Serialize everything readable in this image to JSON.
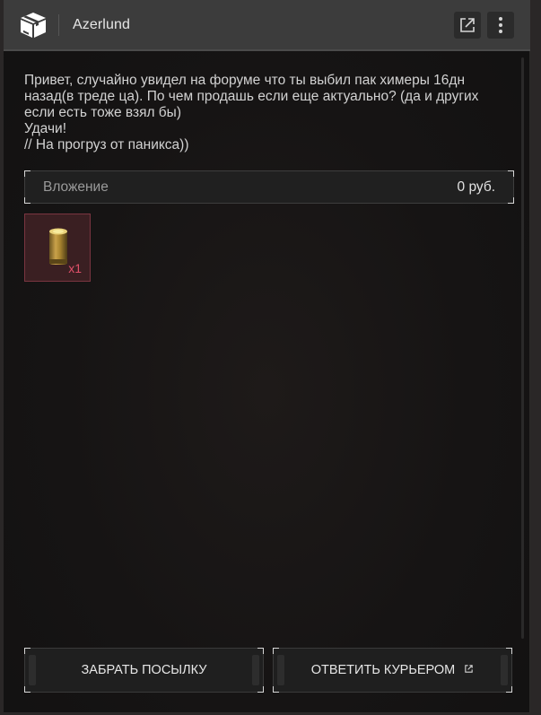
{
  "header": {
    "title": "Azerlund",
    "app_icon": "package-box-icon",
    "open_external_icon": "external-link-icon",
    "menu_icon": "vertical-dots-icon"
  },
  "message": {
    "text": "Привет, случайно увидел на форуме что ты выбил пак химеры 16дн\nназад(в треде ца). По чем продашь если еще актуально? (да и других\nесли есть тоже взял бы)\nУдачи!\n// На прогруз от паникса))"
  },
  "attachment": {
    "label": "Вложение",
    "amount": "0 руб."
  },
  "items": [
    {
      "icon": "cartridge-icon",
      "count": "x1"
    }
  ],
  "actions": {
    "take_label": "ЗАБРАТЬ ПОСЫЛКУ",
    "reply_label": "ОТВЕТИТЬ КУРЬЕРОМ"
  },
  "colors": {
    "header_bg": "#3c3c3c",
    "item_border": "#7a3540",
    "item_count": "#e0506a"
  }
}
